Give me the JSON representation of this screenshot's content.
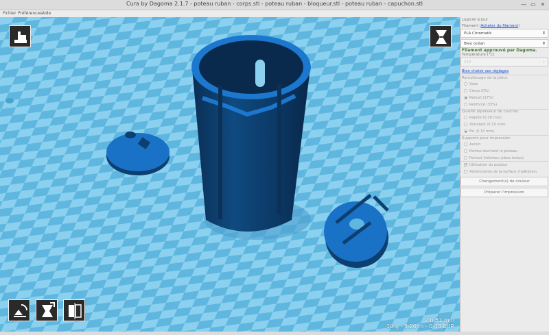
{
  "window": {
    "title": "Cura by Dagoma 2.1.7 - poteau ruban - corps.stl - poteau ruban - bloqueur.stl - poteau ruban - capuchon.stl"
  },
  "menu": {
    "items": [
      "Fichier",
      "Préférences",
      "Aide"
    ]
  },
  "viewport": {
    "estimate_time": "2 h 51 min",
    "estimate_material": "10 g - 3.26 m - 0.43 EUR"
  },
  "panel": {
    "printer_label": "Logiciel à jour",
    "filament_label": "Filament (",
    "filament_link": "Acheter du filament",
    "filament_label_end": ")",
    "filament_value": "PLA Chromatik",
    "color_value": "Bleu océan",
    "approved": "Filament approuvé par Dagoma.",
    "temperature_label": "Température (°C)",
    "temperature_value": "210",
    "settings_link": "Bien choisir ses réglages",
    "infill_label": "Remplissage de la pièce",
    "infill_options": [
      "Vase",
      "Creux (0%)",
      "Rempli (17%)",
      "Renforcé (33%)"
    ],
    "quality_label": "Qualité (épaisseur de couche)",
    "quality_options": [
      "Rapide (0.20 mm)",
      "Standard (0.15 mm)",
      "Fin (0.10 mm)"
    ],
    "support_label": "Supports pour impression",
    "support_options": [
      "Aucun",
      "Parties touchant le plateau",
      "Partout (intérieur pièce inclus)"
    ],
    "check_options": [
      "Utilisation du palpeur",
      "Amélioration de la surface d'adhésion"
    ],
    "color_change_button": "Changement(s) de couleur",
    "prepare_button": "Préparer l'impression"
  },
  "colors": {
    "plate": "#5fb7e0",
    "part": "#1a72c7",
    "part_dark": "#0d3f70",
    "approved": "#3c7a2c"
  }
}
